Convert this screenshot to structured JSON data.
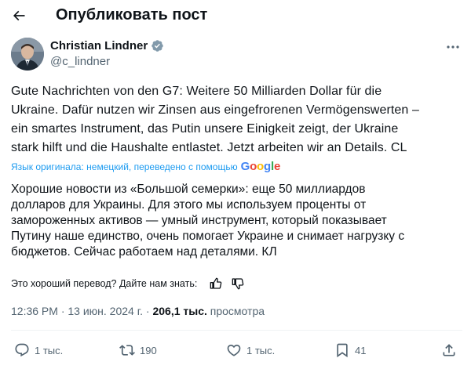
{
  "header": {
    "title": "Опубликовать пост",
    "back_icon": "arrow-left-icon"
  },
  "author": {
    "name": "Christian Lindner",
    "handle": "@c_lindner",
    "verified_icon": "verified-badge-icon",
    "verified_color": "#829aab"
  },
  "tweet": {
    "text": "Gute Nachrichten von den G7: Weitere 50 Milliarden Dollar für die\nUkraine. Dafür nutzen wir Zinsen aus eingefrorenen Vermögenswerten –\nein smartes Instrument, das Putin unsere Einigkeit zeigt, der Ukraine\nstark hilft und die Haushalte entlastet. Jetzt arbeiten wir an Details. CL"
  },
  "translation": {
    "note": "Язык оригинала: немецкий, переведено с помощью",
    "provider": "Google",
    "text": "Хорошие новости из «Большой семерки»: еще 50 миллиардов\nдолларов для Украины. Для этого мы используем проценты от\nзамороженных активов — умный инструмент, который показывает\nПутину наше единство, очень помогает Украине и снимает нагрузку с\nбюджетов. Сейчас работаем над деталями. КЛ",
    "feedback_prompt": "Это хороший перевод? Дайте нам знать:"
  },
  "meta": {
    "time": "12:36 PM",
    "separator": " · ",
    "date": "13 июн. 2024 г.",
    "views_count": "206,1 тыс.",
    "views_label": "просмотра"
  },
  "actions": {
    "replies": "1 тыс.",
    "reposts": "190",
    "likes": "1 тыс.",
    "bookmarks": "41"
  },
  "colors": {
    "text": "#0f1419",
    "secondary": "#536471",
    "link": "#1d9bf0",
    "divider": "#eff3f4"
  }
}
